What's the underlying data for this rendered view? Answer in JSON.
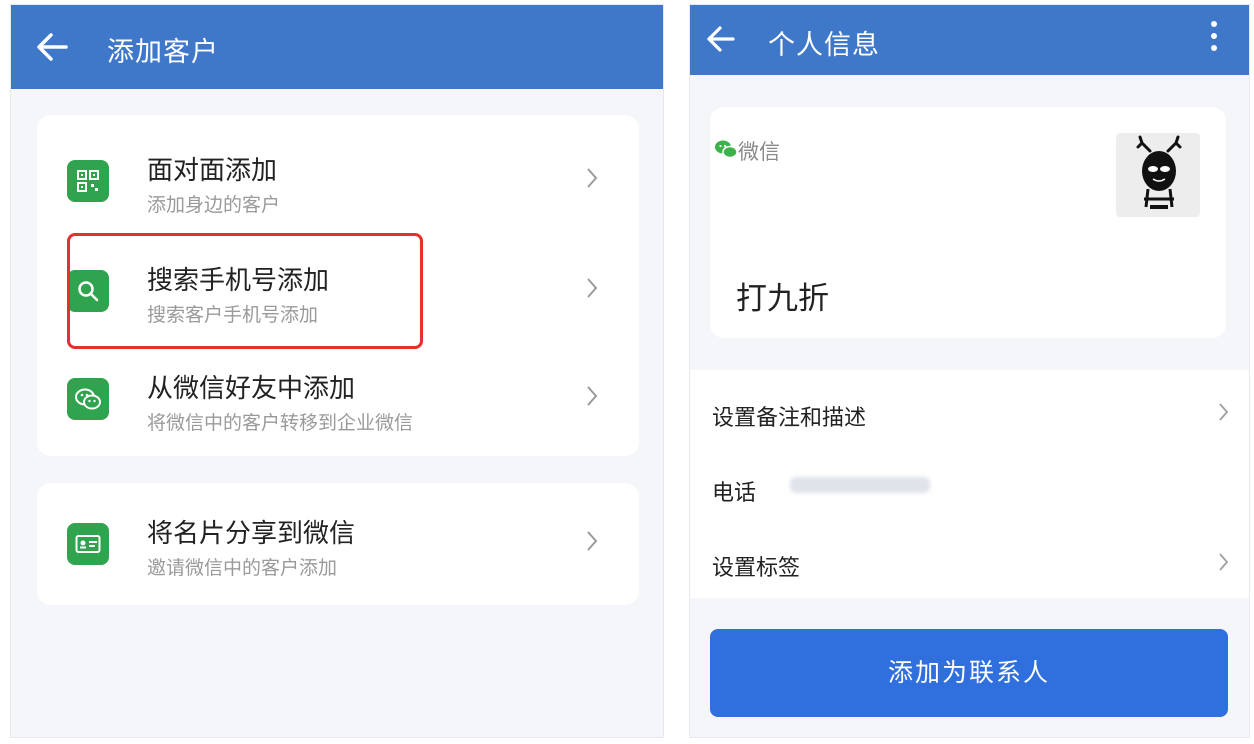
{
  "left": {
    "header": {
      "title": "添加客户"
    },
    "options": [
      {
        "title": "面对面添加",
        "subtitle": "添加身边的客户",
        "icon": "qr-code-icon"
      },
      {
        "title": "搜索手机号添加",
        "subtitle": "搜索客户手机号添加",
        "icon": "search-icon"
      },
      {
        "title": "从微信好友中添加",
        "subtitle": "将微信中的客户转移到企业微信",
        "icon": "wechat-icon"
      }
    ],
    "share": {
      "title": "将名片分享到微信",
      "subtitle": "邀请微信中的客户添加",
      "icon": "business-card-icon"
    },
    "highlight_color": "#e4302f"
  },
  "right": {
    "header": {
      "title": "个人信息"
    },
    "profile": {
      "source_label": "微信",
      "name": "打九折"
    },
    "rows": {
      "remark": "设置备注和描述",
      "phone_label": "电话",
      "tags": "设置标签"
    },
    "add_button": "添加为联系人"
  },
  "colors": {
    "header": "#3f77c9",
    "accent_green": "#2fa34d",
    "button_blue": "#2f6fde"
  }
}
